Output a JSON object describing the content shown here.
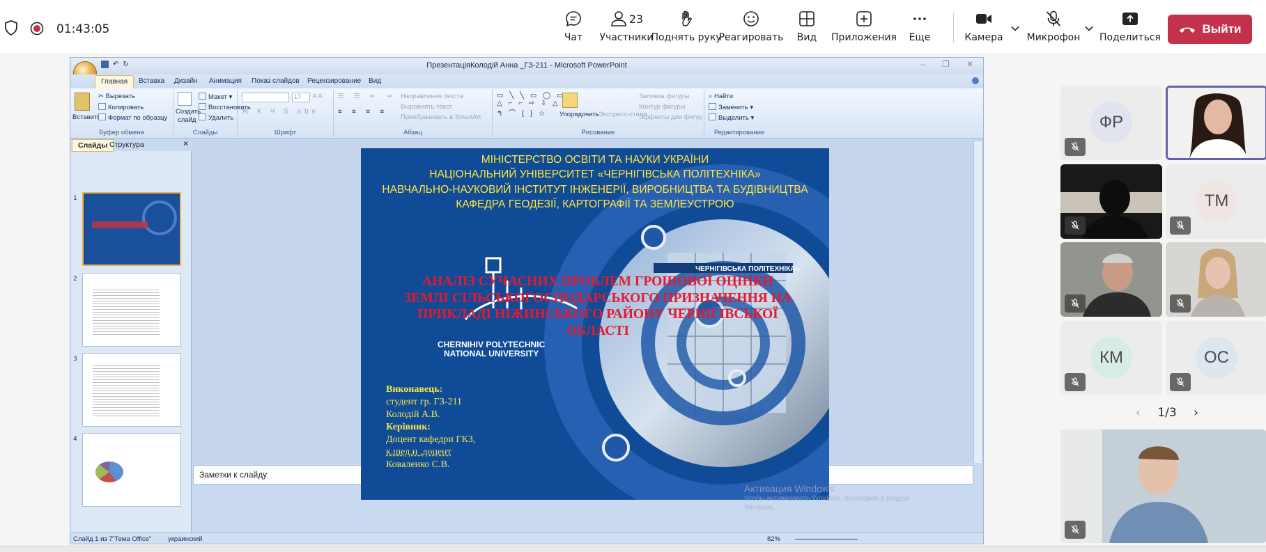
{
  "meeting": {
    "timer": "01:43:05",
    "toolbar": [
      {
        "id": "chat",
        "label": "Чат",
        "icon": "chat-icon"
      },
      {
        "id": "people",
        "label": "Участники",
        "icon": "people-icon",
        "count": "23"
      },
      {
        "id": "raise",
        "label": "Поднять руку",
        "icon": "raise-hand-icon"
      },
      {
        "id": "react",
        "label": "Реагировать",
        "icon": "smile-icon"
      },
      {
        "id": "view",
        "label": "Вид",
        "icon": "grid-view-icon"
      },
      {
        "id": "apps",
        "label": "Приложения",
        "icon": "apps-plus-icon"
      },
      {
        "id": "more",
        "label": "Еще",
        "icon": "more-icon"
      },
      {
        "id": "camera",
        "label": "Камера",
        "icon": "camera-icon"
      },
      {
        "id": "mic",
        "label": "Микрофон",
        "icon": "mic-off-icon"
      },
      {
        "id": "share",
        "label": "Поделиться",
        "icon": "share-icon"
      }
    ],
    "leave_label": "Выйти",
    "colors": {
      "leave": "#c4314b",
      "accent": "#6264a7"
    }
  },
  "ppt": {
    "title": "ПрезентаціяКолодій Анна _ГЗ-211 - Microsoft PowerPoint",
    "tabs": [
      "Главная",
      "Вставка",
      "Дизайн",
      "Анимация",
      "Показ слайдов",
      "Рецензирование",
      "Вид"
    ],
    "ribbon": {
      "clipboard": {
        "paste": "Вставить",
        "cut": "Вырезать",
        "copy": "Копировать",
        "format": "Формат по образцу",
        "group": "Буфер обмена"
      },
      "slides": {
        "create": "Создать",
        "create2": "слайд",
        "layout": "Макет",
        "reset": "Восстановить",
        "delete": "Удалить",
        "group": "Слайды"
      },
      "font": {
        "size": "17",
        "group": "Шрифт"
      },
      "paragraph": {
        "direction": "Направление текста",
        "align": "Выровнять текст",
        "smartart": "Преобразовать в SmartArt",
        "group": "Абзац"
      },
      "drawing": {
        "arrange": "Упорядочить",
        "quick": "Экспресс-стили",
        "fill": "Заливка фигуры",
        "outline": "Контур фигуры",
        "effects": "Эффекты для фигур",
        "group": "Рисование"
      },
      "editing": {
        "find": "Найти",
        "replace": "Заменить",
        "select": "Выделить",
        "group": "Редактирование"
      }
    },
    "pane_tabs": [
      "Слайды",
      "Структура"
    ],
    "thumb_numbers": [
      "1",
      "2",
      "3",
      "4"
    ],
    "notes_placeholder": "Заметки к слайду",
    "status": {
      "slide": "Слайд 1 из 7",
      "theme": "\"Тема Office\"",
      "lang": "украинский",
      "zoom": "82%"
    }
  },
  "slide": {
    "header": [
      "МІНІСТЕРСТВО ОСВІТИ ТА НАУКИ УКРАЇНИ",
      "НАЦІОНАЛЬНИЙ УНІВЕРСИТЕТ «ЧЕРНІГІВСЬКА ПОЛІТЕХНІКА»",
      "НАВЧАЛЬНО-НАУКОВИЙ ІНСТИТУТ ІНЖЕНЕРІЇ, ВИРОБНИЦТВА ТА БУДІВНИЦТВА",
      "КАФЕДРА ГЕОДЕЗІЇ, КАРТОГРАФІЇ ТА ЗЕМЛЕУСТРОЮ"
    ],
    "title": [
      "АНАЛІЗ СУЧАСНИХ ПРОБЛЕМ ГРОШОВОЇ ОЦІНКИ",
      "ЗЕМЛІ СІЛЬСЬКОГОСПОДАРСЬКОГО ПРИЗНАЧЕННЯ НА",
      "ПРИКЛАДІ НІЖИНСЬКОГО РАЙОНУ ЧЕРНІГІВСЬКОЇ",
      "ОБЛАСТІ"
    ],
    "logo": [
      "CHERNIHIV POLYTECHNIC",
      "NATIONAL UNIVERSITY"
    ],
    "building_sign": "ЧЕРНІГІВСЬКА ПОЛІТЕХНІКА»",
    "author": [
      {
        "text": "Виконавець:",
        "bold": true
      },
      {
        "text": "студент гр. ГЗ-211",
        "bold": false
      },
      {
        "text": "Колодій А.В.",
        "bold": false
      },
      {
        "text": "Керівник:",
        "bold": true
      },
      {
        "text": "Доцент кафедри  ГКЗ,",
        "bold": false
      },
      {
        "text": "к.шед.н ,доцент",
        "bold": false
      },
      {
        "text": "Коваленко С.В.",
        "bold": false
      }
    ],
    "colors": {
      "bg": "#104b98",
      "header": "#ffe53b",
      "title": "#e8192c",
      "author": "#f2e64a"
    }
  },
  "watermark": {
    "title": "Активация Windows",
    "sub": "Чтобы активировать Windows, перейдите в раздел",
    "sub2": "Windows."
  },
  "participants": [
    {
      "initials": "ФР",
      "muted": true,
      "video": false
    },
    {
      "initials": "",
      "muted": false,
      "video": true
    },
    {
      "initials": "",
      "muted": true,
      "video": true
    },
    {
      "initials": "ТМ",
      "muted": true,
      "video": false
    },
    {
      "initials": "",
      "muted": true,
      "video": true
    },
    {
      "initials": "",
      "muted": true,
      "video": true
    },
    {
      "initials": "КМ",
      "muted": true,
      "video": false
    },
    {
      "initials": "ОС",
      "muted": true,
      "video": false
    }
  ],
  "pager": {
    "text": "1/3"
  }
}
